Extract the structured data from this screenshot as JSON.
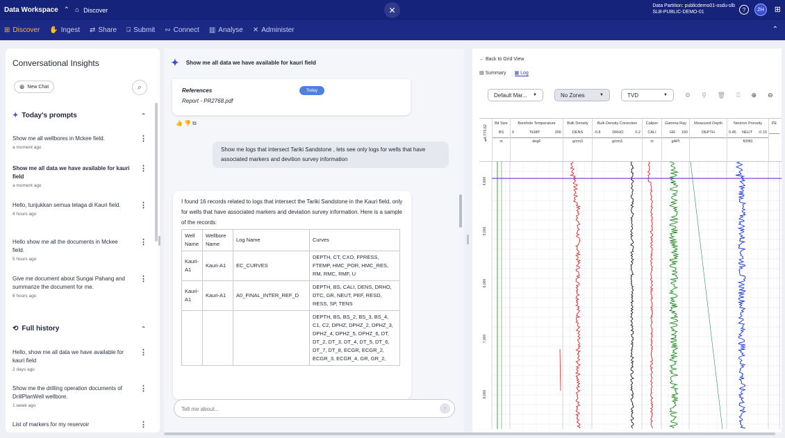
{
  "topbar": {
    "app_title": "Data Workspace",
    "breadcrumb": "Discover",
    "partition_line1": "Data Partition: publicdemo01-osdu-slb",
    "partition_line2": "SLB-PUBLIC-DEMO-01",
    "avatar_initials": "ZH"
  },
  "nav": {
    "items": [
      {
        "label": "Discover",
        "icon": "grid-icon"
      },
      {
        "label": "Ingest",
        "icon": "hand-icon"
      },
      {
        "label": "Share",
        "icon": "share-icon"
      },
      {
        "label": "Submit",
        "icon": "submit-icon"
      },
      {
        "label": "Connect",
        "icon": "connect-icon"
      },
      {
        "label": "Analyse",
        "icon": "chart-icon"
      },
      {
        "label": "Administer",
        "icon": "tools-icon"
      }
    ],
    "active_color": "#f3b540"
  },
  "left": {
    "title": "Conversational Insights",
    "new_chat": "New Chat",
    "today_header": "Today's prompts",
    "today": [
      {
        "text": "Show me all wellbores in Mckee field.",
        "time": "a moment ago",
        "bold": false
      },
      {
        "text": "Show me all data we have available for kauri field",
        "time": "a moment ago",
        "bold": true
      },
      {
        "text": "Hello, tunjukkan semua telaga di Kauri field.",
        "time": "4 hours ago",
        "bold": false
      },
      {
        "text": "Hello show me all the documents in Mckee field.",
        "time": "5 hours ago",
        "bold": false
      },
      {
        "text": "Give me document about Sungai Pahang and summarize the document for me.",
        "time": "6 hours ago",
        "bold": false
      }
    ],
    "history_header": "Full history",
    "history": [
      {
        "text": "Hello, show me all data we have available for kauri field",
        "time": "2 days ago"
      },
      {
        "text": "Show me the drilling operation documents of DrillPlanWell wellbore.",
        "time": "1 week ago"
      },
      {
        "text": "List of markers for my reservoir",
        "time": ""
      }
    ]
  },
  "chat": {
    "heading": "Show me all data we have available for kauri field",
    "references_title": "References",
    "reference_file": "Report - PR2768.pdf",
    "badge": "Today",
    "user_message": "Show me logs  that  intersect Tariki Sandstone , lets see only logs for wells that have associated markers and devition survey information",
    "answer_intro": "I found 16 records related to logs that intersect the Tariki Sandstone in the Kauri field, only for wells that have associated markers and deviation survey information. Here is a sample of the records:",
    "table_headers": [
      "Well Name",
      "Wellbore Name",
      "Log Name",
      "Curves"
    ],
    "table_rows": [
      [
        "Kauri-A1",
        "Kauri-A1",
        "EC_CURVES",
        "DEPTH, CT, CXO, FPRESS, FTEMP, HMC_POR, HMC_RES, RM, RMC, RMF, U"
      ],
      [
        "Kauri-A1",
        "Kauri-A1",
        "A0_FINAL_INTER_REF_D",
        "DEPTH, BS, CALI, DENS, DRHO, DTC, GR, NEUT, PEF, RESD, RESS, SP, TENS"
      ],
      [
        "",
        "",
        "",
        "DEPTH, BS, BS_2, BS_3, BS_4, C1, C2, DPHZ, DPHZ_2, DPHZ_3, DPHZ_4, DPHZ_5, DPHZ_6, DT, DT_2, DT_3, DT_4, DT_5, DT_6, DT_7, DT_8, ECGR, ECGR_2, ECGR_3, ECGR_4, GR, GR_2,"
      ]
    ],
    "input_placeholder": "Tell me about..."
  },
  "viewer": {
    "back_label": "Back to Grid View",
    "tabs": [
      "Summary",
      "Log"
    ],
    "active_tab": "Log",
    "dropdown1": "Default Mar...",
    "dropdown2": "No Zones",
    "dropdown3": "TVD",
    "depth_top": "4,773.62",
    "depth_unit_label": "ft",
    "depth_ticks": [
      "4,800",
      "5,000",
      "6,000",
      "7,000",
      "8,000"
    ],
    "tracks": [
      {
        "name": "Bit Size",
        "mnem": "BS",
        "min": "",
        "max": "",
        "unit": "in"
      },
      {
        "name": "Borehole Temperature",
        "mnem": "TEMP",
        "min": "0",
        "max": "200",
        "unit": "degF"
      },
      {
        "name": "Bulk Density",
        "mnem": "DENS",
        "min": "",
        "max": "",
        "unit": "g/cm3"
      },
      {
        "name": "Bulk Density Correction",
        "mnem": "DRHO",
        "min": "-0.8",
        "max": "0.2",
        "unit": "g/cm3"
      },
      {
        "name": "Caliper",
        "mnem": "CALI",
        "min": "",
        "max": "",
        "unit": "in"
      },
      {
        "name": "Gamma Ray",
        "mnem": "GR",
        "min": "",
        "max": "150",
        "unit": "gAPI"
      },
      {
        "name": "Measured Depth",
        "mnem": "DEPTH",
        "min": "",
        "max": "",
        "unit": ""
      },
      {
        "name": "Neutron Porosity",
        "mnem": "NEUT",
        "min": "0.45",
        "max": "-0.15",
        "unit": "ft3/ft3"
      },
      {
        "name": "PE",
        "mnem": "",
        "min": "",
        "max": "",
        "unit": ""
      }
    ],
    "curve_colors": {
      "density": "#e02020",
      "drho": "#111111",
      "caliper": "#e02020",
      "gr": "#1a8a1a",
      "neut": "#1030e0",
      "marker": "#8a3cc8"
    }
  }
}
